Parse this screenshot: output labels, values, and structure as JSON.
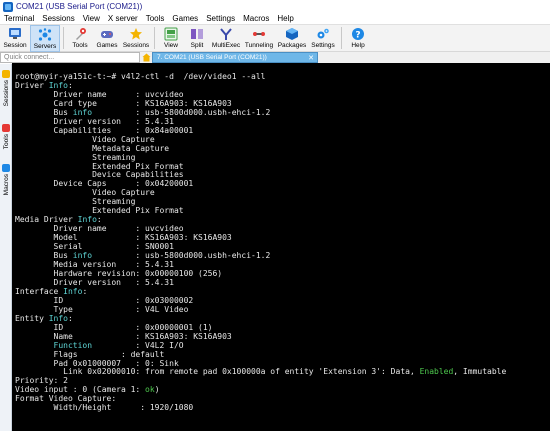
{
  "window": {
    "title": "COM21  (USB Serial Port (COM21))"
  },
  "menu": [
    "Terminal",
    "Sessions",
    "View",
    "X server",
    "Tools",
    "Games",
    "Settings",
    "Macros",
    "Help"
  ],
  "toolbar": {
    "items": [
      {
        "label": "Session",
        "icon": "session-icon",
        "color": "#2a6cc9"
      },
      {
        "label": "Servers",
        "icon": "servers-icon",
        "color": "#1e88e5"
      },
      {
        "label": "Tools",
        "icon": "tools-icon",
        "color": "#e53935"
      },
      {
        "label": "Games",
        "icon": "games-icon",
        "color": "#5c6bc0"
      },
      {
        "label": "Sessions",
        "icon": "star-icon",
        "color": "#f4b400"
      },
      {
        "label": "View",
        "icon": "view-icon",
        "color": "#43a047"
      },
      {
        "label": "Split",
        "icon": "split-icon",
        "color": "#7e57c2"
      },
      {
        "label": "MultiExec",
        "icon": "multiexec-icon",
        "color": "#3949ab"
      },
      {
        "label": "Tunneling",
        "icon": "tunneling-icon",
        "color": "#e53935"
      },
      {
        "label": "Packages",
        "icon": "packages-icon",
        "color": "#1565c0"
      },
      {
        "label": "Settings",
        "icon": "gear-icon",
        "color": "#1e88e5"
      },
      {
        "label": "Help",
        "icon": "help-icon",
        "color": "#1e88e5"
      }
    ]
  },
  "quick_connect": {
    "placeholder": "Quick connect..."
  },
  "sidebar": {
    "tabs": [
      "Sessions",
      "Tools",
      "Macros"
    ]
  },
  "tab": {
    "label": "7. COM21  (USB Serial Port (COM21))"
  },
  "terminal": {
    "lines": [
      [
        {
          "t": "root@myir-ya151c-t:~# v4l2-ctl -d  /dev/video1 --all"
        }
      ],
      [
        {
          "t": "Driver "
        },
        {
          "t": "Info",
          "c": "cyan"
        },
        {
          "t": ":"
        }
      ],
      [
        {
          "t": "        Driver name      : uvcvideo"
        }
      ],
      [
        {
          "t": "        Card type        : KS16A903: KS16A903"
        }
      ],
      [
        {
          "t": "        Bus "
        },
        {
          "t": "info",
          "c": "cyan"
        },
        {
          "t": "         : usb-5800d000.usbh-ehci-1.2"
        }
      ],
      [
        {
          "t": "        Driver version   : 5.4.31"
        }
      ],
      [
        {
          "t": "        Capabilities     : 0x84a00001"
        }
      ],
      [
        {
          "t": "                Video Capture"
        }
      ],
      [
        {
          "t": "                Metadata Capture"
        }
      ],
      [
        {
          "t": "                Streaming"
        }
      ],
      [
        {
          "t": "                Extended Pix Format"
        }
      ],
      [
        {
          "t": "                Device Capabilities"
        }
      ],
      [
        {
          "t": "        Device Caps      : 0x04200001"
        }
      ],
      [
        {
          "t": "                Video Capture"
        }
      ],
      [
        {
          "t": "                Streaming"
        }
      ],
      [
        {
          "t": "                Extended Pix Format"
        }
      ],
      [
        {
          "t": "Media Driver "
        },
        {
          "t": "Info",
          "c": "cyan"
        },
        {
          "t": ":"
        }
      ],
      [
        {
          "t": "        Driver name      : uvcvideo"
        }
      ],
      [
        {
          "t": "        Model            : KS16A903: KS16A903"
        }
      ],
      [
        {
          "t": "        Serial           : SN0001"
        }
      ],
      [
        {
          "t": "        Bus "
        },
        {
          "t": "info",
          "c": "cyan"
        },
        {
          "t": "         : usb-5800d000.usbh-ehci-1.2"
        }
      ],
      [
        {
          "t": "        Media version    : 5.4.31"
        }
      ],
      [
        {
          "t": "        Hardware revision: 0x00000100 (256)"
        }
      ],
      [
        {
          "t": "        Driver version   : 5.4.31"
        }
      ],
      [
        {
          "t": "Interface "
        },
        {
          "t": "Info",
          "c": "cyan"
        },
        {
          "t": ":"
        }
      ],
      [
        {
          "t": "        ID               : 0x03000002"
        }
      ],
      [
        {
          "t": "        Type             : V4L Video"
        }
      ],
      [
        {
          "t": "Entity "
        },
        {
          "t": "Info",
          "c": "cyan"
        },
        {
          "t": ":"
        }
      ],
      [
        {
          "t": "        ID               : 0x00000001 (1)"
        }
      ],
      [
        {
          "t": "        Name             : KS16A903: KS16A903"
        }
      ],
      [
        {
          "t": "        "
        },
        {
          "t": "Function",
          "c": "cyan"
        },
        {
          "t": "         : V4L2 I/O"
        }
      ],
      [
        {
          "t": "        Flags         : default"
        }
      ],
      [
        {
          "t": "        Pad 0x01000007   : 0: Sink"
        }
      ],
      [
        {
          "t": "          Link 0x02000010: from remote pad 0x100000a of entity 'Extension 3': Data, "
        },
        {
          "t": "Enabled",
          "c": "green"
        },
        {
          "t": ", Immutable"
        }
      ],
      [
        {
          "t": "Priority: 2"
        }
      ],
      [
        {
          "t": "Video input : 0 (Camera 1: "
        },
        {
          "t": "ok",
          "c": "green"
        },
        {
          "t": ")"
        }
      ],
      [
        {
          "t": "Format Video Capture:"
        }
      ],
      [
        {
          "t": "        Width/Height      : 1920/1080"
        }
      ]
    ]
  }
}
